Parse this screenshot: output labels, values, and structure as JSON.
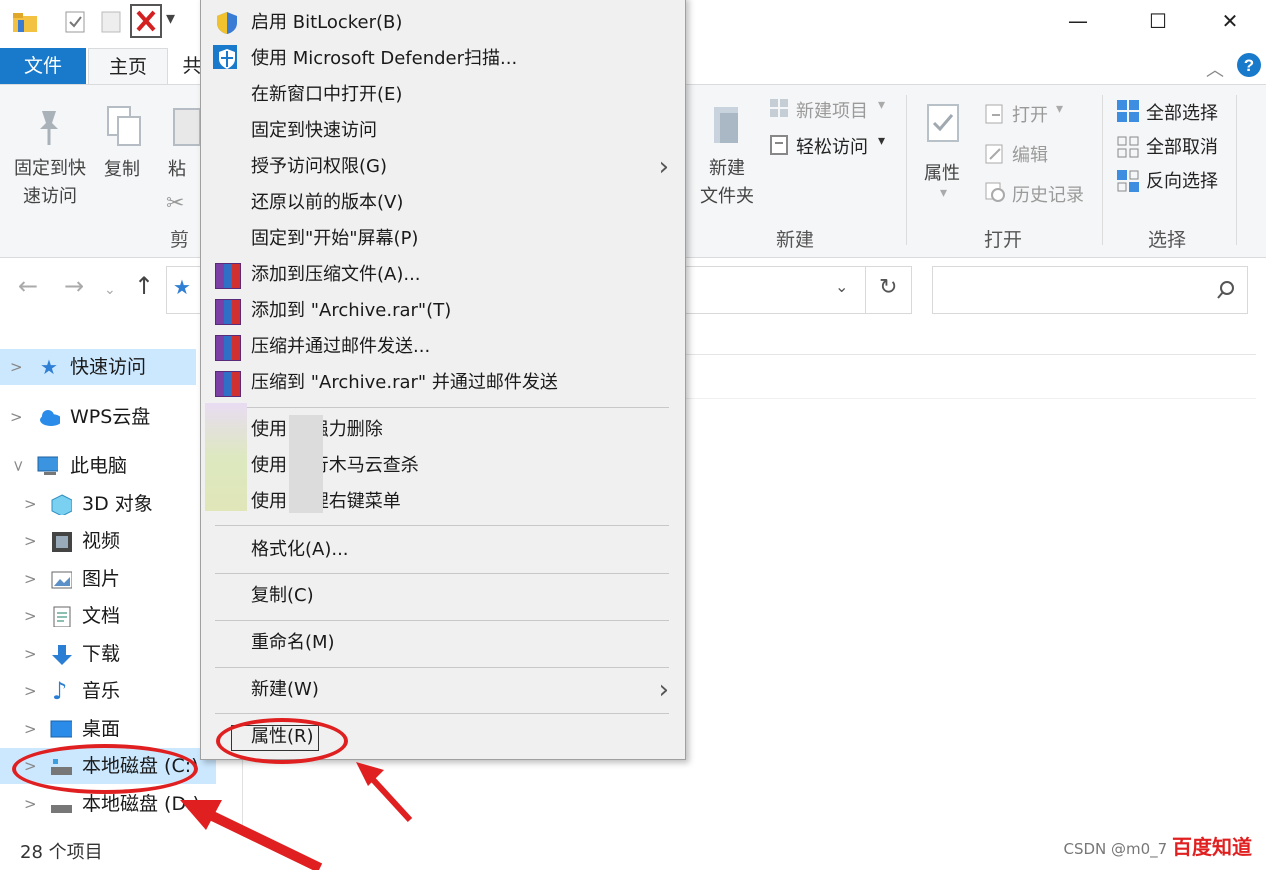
{
  "window": {
    "minimize": "—",
    "maximize": "☐",
    "close": "✕"
  },
  "tabs": {
    "file": "文件",
    "home": "主页",
    "share_partial": "共"
  },
  "ribbon": {
    "pin_quick_access": "固定到快\n速访问",
    "copy": "复制",
    "paste_partial": "粘",
    "clipboard_group_partial": "剪",
    "new_folder": "新建\n文件夹",
    "new_item": "新建项目",
    "easy_access": "轻松访问",
    "new_group": "新建",
    "properties": "属性",
    "open": "打开",
    "edit": "编辑",
    "history": "历史记录",
    "open_group": "打开",
    "select_all": "全部选择",
    "select_none": "全部取消",
    "invert_selection": "反向选择",
    "select_group": "选择"
  },
  "address_bar": {
    "refresh": "↻",
    "search_placeholder": ""
  },
  "nav_pane": {
    "items": [
      {
        "label": "快速访问",
        "icon": "star-icon"
      },
      {
        "label": "WPS云盘",
        "icon": "cloud-icon"
      },
      {
        "label": "此电脑",
        "icon": "computer-icon"
      },
      {
        "label": "3D 对象",
        "icon": "cube-icon"
      },
      {
        "label": "视频",
        "icon": "video-icon"
      },
      {
        "label": "图片",
        "icon": "picture-icon"
      },
      {
        "label": "文档",
        "icon": "document-icon"
      },
      {
        "label": "下载",
        "icon": "download-icon"
      },
      {
        "label": "音乐",
        "icon": "music-icon"
      },
      {
        "label": "桌面",
        "icon": "desktop-icon"
      },
      {
        "label": "本地磁盘 (C:)",
        "icon": "drive-icon"
      },
      {
        "label": "本地磁盘 (D:)",
        "icon": "drive-icon"
      }
    ]
  },
  "status": {
    "count": "28 个项目"
  },
  "context_menu": {
    "bitlocker": "启用 BitLocker(B)",
    "defender": "使用 Microsoft Defender扫描...",
    "open_new_window": "在新窗口中打开(E)",
    "pin_quick": "固定到快速访问",
    "grant_access": "授予访问权限(G)",
    "restore_versions": "还原以前的版本(V)",
    "pin_start": "固定到\"开始\"屏幕(P)",
    "add_archive": "添加到压缩文件(A)...",
    "add_archive_rar": "添加到 \"Archive.rar\"(T)",
    "compress_email": "压缩并通过邮件发送...",
    "compress_rar_email": "压缩到 \"Archive.rar\" 并通过邮件发送",
    "force_delete": "使用        的强力删除",
    "trojan_scan": "使用        进行木马云查杀",
    "manage_menu": "使用        管理右键菜单",
    "format": "格式化(A)...",
    "copy": "复制(C)",
    "rename": "重命名(M)",
    "new": "新建(W)",
    "properties": "属性(R)"
  },
  "watermark": {
    "csdn": "CSDN @m0_7",
    "baidu": "百度知道"
  },
  "colors": {
    "accent": "#1979ca",
    "selection": "#cce8ff",
    "annotation": "#e02020"
  }
}
